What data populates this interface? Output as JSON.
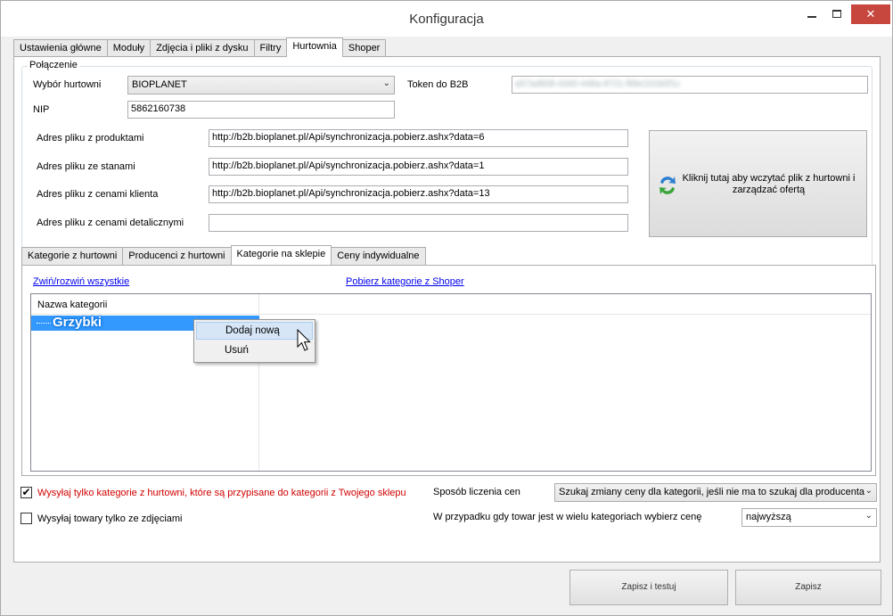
{
  "window": {
    "title": "Konfiguracja"
  },
  "main_tabs": [
    "Ustawienia główne",
    "Moduły",
    "Zdjęcia i pliki z dysku",
    "Filtry",
    "Hurtownia",
    "Shoper"
  ],
  "connection": {
    "group_label": "Połączenie",
    "wholesaler_label": "Wybór hurtowni",
    "wholesaler_value": "BIOPLANET",
    "token_label": "Token do B2B",
    "token_value": "a57ad808-4340-448a-9721-f89e161b0f1c",
    "nip_label": "NIP",
    "nip_value": "5862160738",
    "products_url_label": "Adres pliku z produktami",
    "products_url": "http://b2b.bioplanet.pl/Api/synchronizacja.pobierz.ashx?data=6",
    "stock_url_label": "Adres pliku ze stanami",
    "stock_url": "http://b2b.bioplanet.pl/Api/synchronizacja.pobierz.ashx?data=1",
    "client_prices_url_label": "Adres pliku z cenami klienta",
    "client_prices_url": "http://b2b.bioplanet.pl/Api/synchronizacja.pobierz.ashx?data=13",
    "retail_prices_url_label": "Adres pliku z cenami detalicznymi",
    "retail_prices_url": "",
    "load_button_label": "Kliknij tutaj aby wczytać plik z hurtowni i zarządzać ofertą"
  },
  "sub_tabs": [
    "Kategorie z hurtowni",
    "Producenci z hurtowni",
    "Kategorie na sklepie",
    "Ceny indywidualne"
  ],
  "categories": {
    "collapse_link": "Zwiń/rozwiń wszystkie",
    "fetch_link": "Pobierz kategorie z Shoper",
    "column_header": "Nazwa kategorii",
    "selected_item": "Grzybki"
  },
  "context_menu": {
    "items": [
      "Dodaj nową",
      "Usuń"
    ]
  },
  "options": {
    "only_assigned_label": "Wysyłaj tylko kategorie z hurtowni, które są przypisane do kategorii z Twojego sklepu",
    "only_assigned_checked": true,
    "only_photos_label": "Wysyłaj towary tylko ze zdjęciami",
    "only_photos_checked": false,
    "price_method_label": "Sposób liczenia cen",
    "price_method_value": "Szukaj zmiany ceny dla kategorii, jeśli nie ma to szukaj dla producenta",
    "multi_category_label": "W przypadku gdy towar jest w wielu kategoriach wybierz cenę",
    "multi_category_value": "najwyższą"
  },
  "buttons": {
    "save_test": "Zapisz i testuj",
    "save": "Zapisz"
  },
  "checkmark": "✔"
}
